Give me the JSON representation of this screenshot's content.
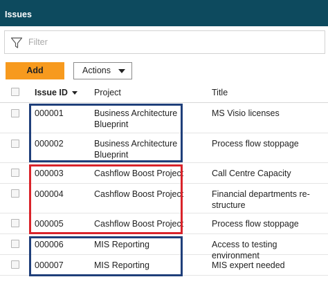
{
  "header": {
    "title": "Issues"
  },
  "filter": {
    "placeholder": "Filter",
    "icon": "funnel-icon"
  },
  "toolbar": {
    "add_label": "Add",
    "actions_label": "Actions"
  },
  "table": {
    "columns": [
      "Issue ID",
      "Project",
      "Title"
    ],
    "sort_column": "Issue ID",
    "rows": [
      {
        "id": "000001",
        "project": "Business Architecture Blueprint",
        "title": "MS Visio licenses"
      },
      {
        "id": "000002",
        "project": "Business Architecture Blueprint",
        "title": "Process flow stoppage"
      },
      {
        "id": "000003",
        "project": "Cashflow Boost Project",
        "title": "Call Centre Capacity"
      },
      {
        "id": "000004",
        "project": "Cashflow Boost Project",
        "title": "Financial departments re-structure"
      },
      {
        "id": "000005",
        "project": "Cashflow Boost Project",
        "title": "Process flow stoppage"
      },
      {
        "id": "000006",
        "project": "MIS Reporting",
        "title": "Access to testing environment"
      },
      {
        "id": "000007",
        "project": "MIS Reporting",
        "title": "MIS expert needed"
      }
    ]
  },
  "colors": {
    "header_bg": "#0d4a5e",
    "add_button": "#f79a1e",
    "highlight_blue": "#1f3f7a",
    "highlight_red": "#d9232a"
  }
}
